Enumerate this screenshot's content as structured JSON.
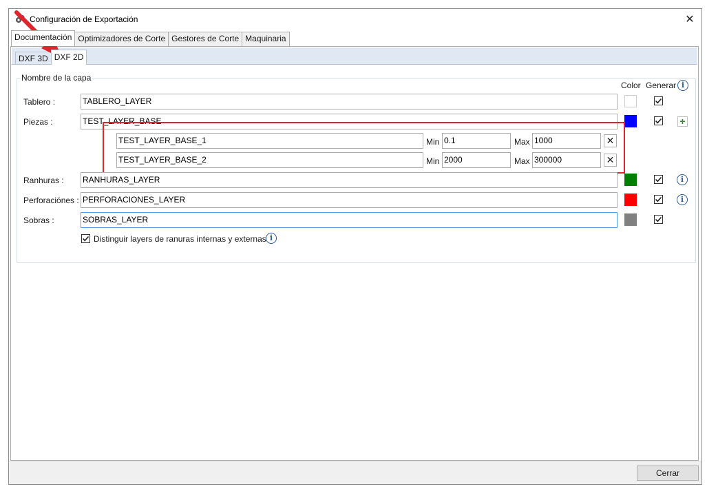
{
  "window": {
    "title": "Configuración de Exportación",
    "close_glyph": "✕"
  },
  "tabs": [
    {
      "label": "Documentación",
      "active": true
    },
    {
      "label": "Optimizadores de Corte",
      "active": false
    },
    {
      "label": "Gestores de Corte",
      "active": false
    },
    {
      "label": "Maquinaria",
      "active": false
    }
  ],
  "subtabs": [
    {
      "label": "DXF 3D",
      "active": false
    },
    {
      "label": "DXF 2D",
      "active": true
    }
  ],
  "group": {
    "legend": "Nombre de la capa",
    "col_color": "Color",
    "col_generar": "Generar"
  },
  "rows": {
    "tablero": {
      "label": "Tablero :",
      "value": "TABLERO_LAYER",
      "color": "#ffffff",
      "generar": true
    },
    "piezas": {
      "label": "Piezas :",
      "value": "TEST_LAYER_BASE",
      "color": "#0000ff",
      "generar": true
    },
    "ranhuras": {
      "label": "Ranhuras :",
      "value": "RANHURAS_LAYER",
      "color": "#008000",
      "generar": true
    },
    "perforaciones": {
      "label": "Perforaciónes :",
      "value": "PERFORACIONES_LAYER",
      "color": "#ff0000",
      "generar": true
    },
    "sobras": {
      "label": "Sobras :",
      "value": "SOBRAS_LAYER",
      "color": "#808080",
      "generar": true
    }
  },
  "sublayers": [
    {
      "name": "TEST_LAYER_BASE_1",
      "min_label": "Min",
      "min": "0.1",
      "max_label": "Max",
      "max": "1000",
      "remove_glyph": "✕"
    },
    {
      "name": "TEST_LAYER_BASE_2",
      "min_label": "Min",
      "min": "2000",
      "max_label": "Max",
      "max": "300000",
      "remove_glyph": "✕"
    }
  ],
  "distinguish": {
    "label": "Distinguir layers de ranuras internas y externas",
    "checked": true
  },
  "footer": {
    "close_label": "Cerrar"
  },
  "colors": {
    "annotation_red": "#e0242c",
    "info_blue": "#2d5c9f",
    "plus_green": "#2e8b2e"
  }
}
